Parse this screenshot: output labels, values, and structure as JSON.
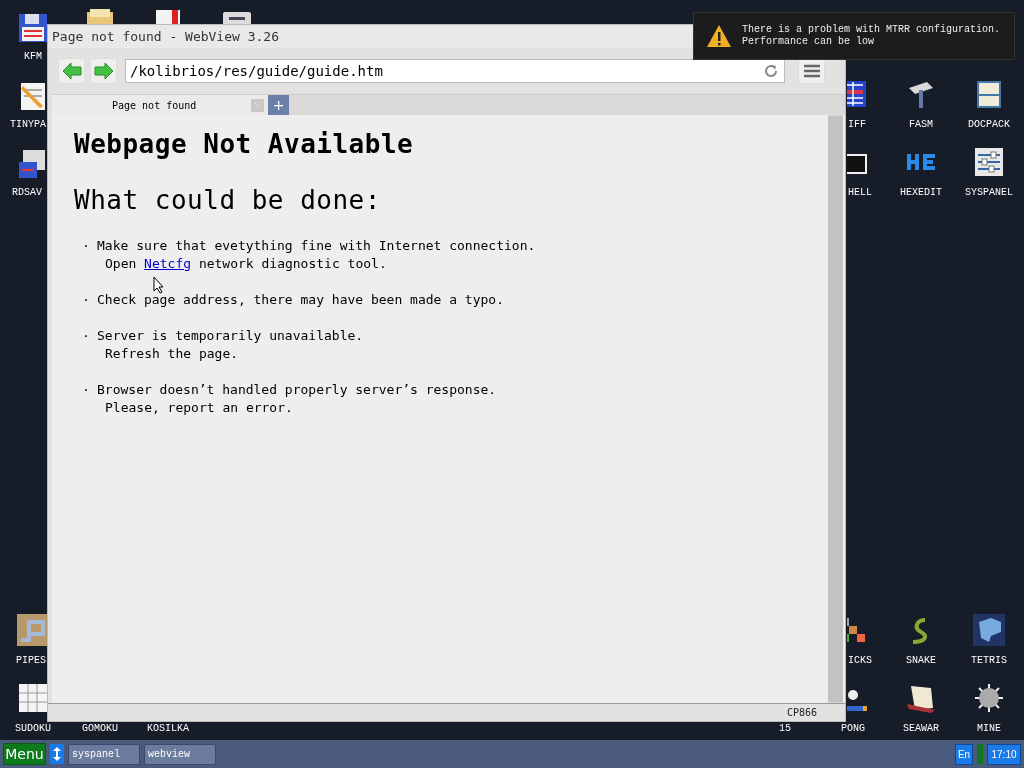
{
  "desktop_icons": [
    {
      "label": "KFM",
      "kind": "floppy"
    },
    {
      "kind": "folder"
    },
    {
      "kind": "book"
    },
    {
      "kind": "device"
    },
    {
      "label": "TINYPA",
      "kind": "notepad"
    },
    {
      "label": "IFF",
      "kind": "grid"
    },
    {
      "label": "FASM",
      "kind": "hammer"
    },
    {
      "label": "DOCPACK",
      "kind": "drawer"
    },
    {
      "label": "RDSAV",
      "kind": "disk"
    },
    {
      "label": "HELL",
      "kind": "terminal"
    },
    {
      "label": "HEXEDIT",
      "kind": "hex"
    },
    {
      "label": "SYSPANEL",
      "kind": "sliders"
    },
    {
      "label": "PIPES",
      "kind": "pipe"
    },
    {
      "label": "ICKS",
      "kind": "blocks"
    },
    {
      "label": "SNAKE",
      "kind": "snake"
    },
    {
      "label": "TETRIS",
      "kind": "cube"
    },
    {
      "label": "SUDOKU",
      "kind": "sudoku"
    },
    {
      "label": "GOMOKU"
    },
    {
      "label": "KOSILKA"
    },
    {
      "label": "15"
    },
    {
      "label": "PONG",
      "kind": "ball"
    },
    {
      "label": "SEAWAR",
      "kind": "ship"
    },
    {
      "label": "MINE",
      "kind": "mine"
    }
  ],
  "window": {
    "title": "Page not found - WebView 3.26",
    "address": "/kolibrios/res/guide/guide.htm",
    "tabs": [
      {
        "label": "Page not found",
        "selected": true
      }
    ],
    "new_tab": "+",
    "page": {
      "heading": "Webpage Not Available",
      "subheading": "What could be done:",
      "items": [
        {
          "bullet": "·",
          "text": "Make sure that evetything fine with Internet connection.",
          "detail": {
            "before": "Open",
            "link": "Netcfg",
            "after": "network diagnostic tool."
          }
        },
        {
          "bullet": "·",
          "text": "Check page address, there may have been made a typo."
        },
        {
          "bullet": "·",
          "text": "Server is temporarily unavailable.",
          "detail": {
            "before": "Refresh the page."
          }
        },
        {
          "bullet": "·",
          "text": "Browser doesn’t handled properly server’s response.",
          "detail": {
            "before": "Please, report an error."
          }
        }
      ]
    },
    "status": "CP866"
  },
  "notification": {
    "lines": [
      "There is a problem with MTRR configuration.",
      "Performance can be low"
    ]
  },
  "taskbar": {
    "menu": "Menu",
    "tasks": [
      "syspanel",
      "webview"
    ],
    "language": "En",
    "clock": "17:10"
  }
}
